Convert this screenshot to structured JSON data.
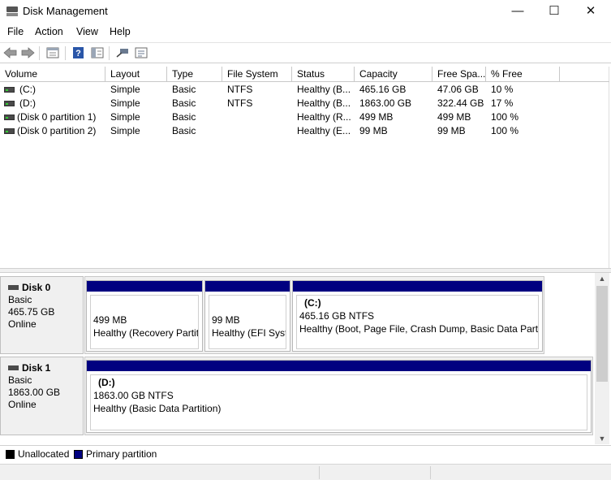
{
  "window": {
    "title": "Disk Management",
    "minimize": "—",
    "maximize": "☐",
    "close": "✕"
  },
  "menu": [
    "File",
    "Action",
    "View",
    "Help"
  ],
  "toolbar": [
    "back-icon",
    "forward-icon",
    "properties-icon",
    "help-icon",
    "show-hide-icon",
    "connect-icon",
    "view-icon"
  ],
  "volume_list": {
    "headers": [
      "Volume",
      "Layout",
      "Type",
      "File System",
      "Status",
      "Capacity",
      "Free Spa...",
      "% Free"
    ],
    "rows": [
      [
        "(C:)",
        "Simple",
        "Basic",
        "NTFS",
        "Healthy (B...",
        "465.16 GB",
        "47.06 GB",
        "10 %"
      ],
      [
        "(D:)",
        "Simple",
        "Basic",
        "NTFS",
        "Healthy (B...",
        "1863.00 GB",
        "322.44 GB",
        "17 %"
      ],
      [
        "(Disk 0 partition 1)",
        "Simple",
        "Basic",
        "",
        "Healthy (R...",
        "499 MB",
        "499 MB",
        "100 %"
      ],
      [
        "(Disk 0 partition 2)",
        "Simple",
        "Basic",
        "",
        "Healthy (E...",
        "99 MB",
        "99 MB",
        "100 %"
      ]
    ]
  },
  "disks": [
    {
      "name": "Disk 0",
      "type": "Basic",
      "size": "465.75 GB",
      "state": "Online",
      "partitions": [
        {
          "title": "",
          "size": "499 MB",
          "status": "Healthy (Recovery Partiti"
        },
        {
          "title": "",
          "size": "99 MB",
          "status": "Healthy (EFI Syste"
        },
        {
          "title": "(C:)",
          "size": "465.16 GB NTFS",
          "status": "Healthy (Boot, Page File, Crash Dump, Basic Data Partitic"
        }
      ]
    },
    {
      "name": "Disk 1",
      "type": "Basic",
      "size": "1863.00 GB",
      "state": "Online",
      "partitions": [
        {
          "title": "(D:)",
          "size": "1863.00 GB NTFS",
          "status": "Healthy (Basic Data Partition)"
        }
      ]
    }
  ],
  "legend": [
    {
      "label": "Unallocated",
      "color": "#000000"
    },
    {
      "label": "Primary partition",
      "color": "#000080"
    }
  ],
  "scroll": {
    "up": "▲",
    "down": "▼"
  }
}
